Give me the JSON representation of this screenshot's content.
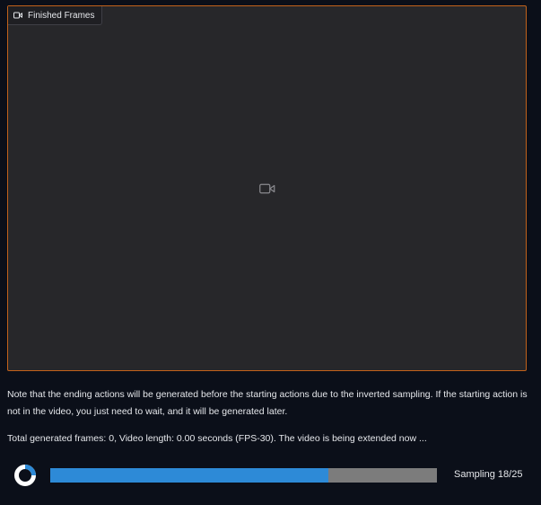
{
  "video_panel": {
    "label": "Finished Frames",
    "label_icon": "video-camera-icon",
    "placeholder_icon": "video-camera-icon",
    "accent_color": "#c2621a"
  },
  "note_text": "Note that the ending actions will be generated before the starting actions due to the inverted sampling. If the starting action is not in the video, you just need to wait, and it will be generated later.",
  "status_text": "Total generated frames: 0, Video length: 0.00 seconds (FPS-30). The video is being extended now ...",
  "progress": {
    "label": "Sampling 18/25",
    "current": 18,
    "total": 25,
    "fill_color": "#2d8ad7",
    "track_color": "#7c7c7c"
  },
  "spinner_icon": "loading-spinner-icon"
}
